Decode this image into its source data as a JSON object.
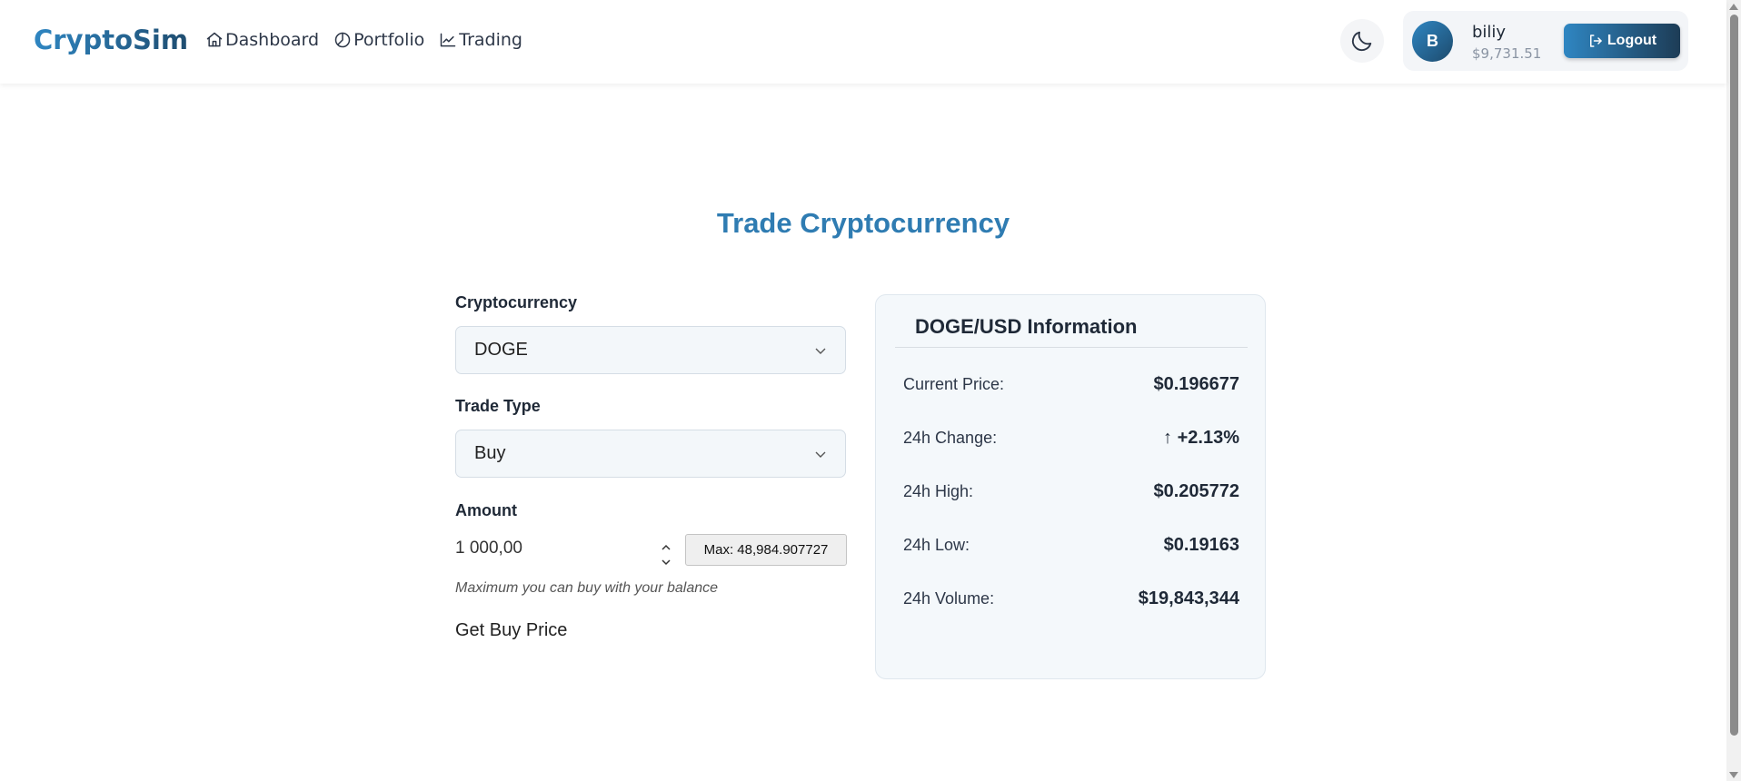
{
  "header": {
    "logo": "CryptoSim",
    "nav": [
      {
        "label": "Dashboard",
        "icon": "home-icon"
      },
      {
        "label": "Portfolio",
        "icon": "pie-chart-icon"
      },
      {
        "label": "Trading",
        "icon": "trending-up-icon"
      }
    ],
    "theme_toggle_icon": "moon-icon",
    "user": {
      "avatar_initial": "B",
      "username": "biliy",
      "balance": "$9,731.51"
    },
    "logout_label": "Logout"
  },
  "main": {
    "title": "Trade Cryptocurrency",
    "form": {
      "crypto_label": "Cryptocurrency",
      "crypto_value": "DOGE",
      "trade_type_label": "Trade Type",
      "trade_type_value": "Buy",
      "amount_label": "Amount",
      "amount_value": "1 000,00",
      "max_button": "Max: 48,984.907727",
      "hint": "Maximum you can buy with your balance",
      "get_price_label": "Get Buy Price"
    },
    "info": {
      "title": "DOGE/USD Information",
      "rows": [
        {
          "key": "Current Price:",
          "value": "$0.196677"
        },
        {
          "key": "24h Change:",
          "arrow": "↑",
          "value": "+2.13%"
        },
        {
          "key": "24h High:",
          "value": "$0.205772"
        },
        {
          "key": "24h Low:",
          "value": "$0.19163"
        },
        {
          "key": "24h Volume:",
          "value": "$19,843,344"
        }
      ]
    }
  },
  "colors": {
    "accent": "#2f7cb2",
    "accent_dark": "#1d3c56",
    "card_bg": "#f4f8fb"
  }
}
